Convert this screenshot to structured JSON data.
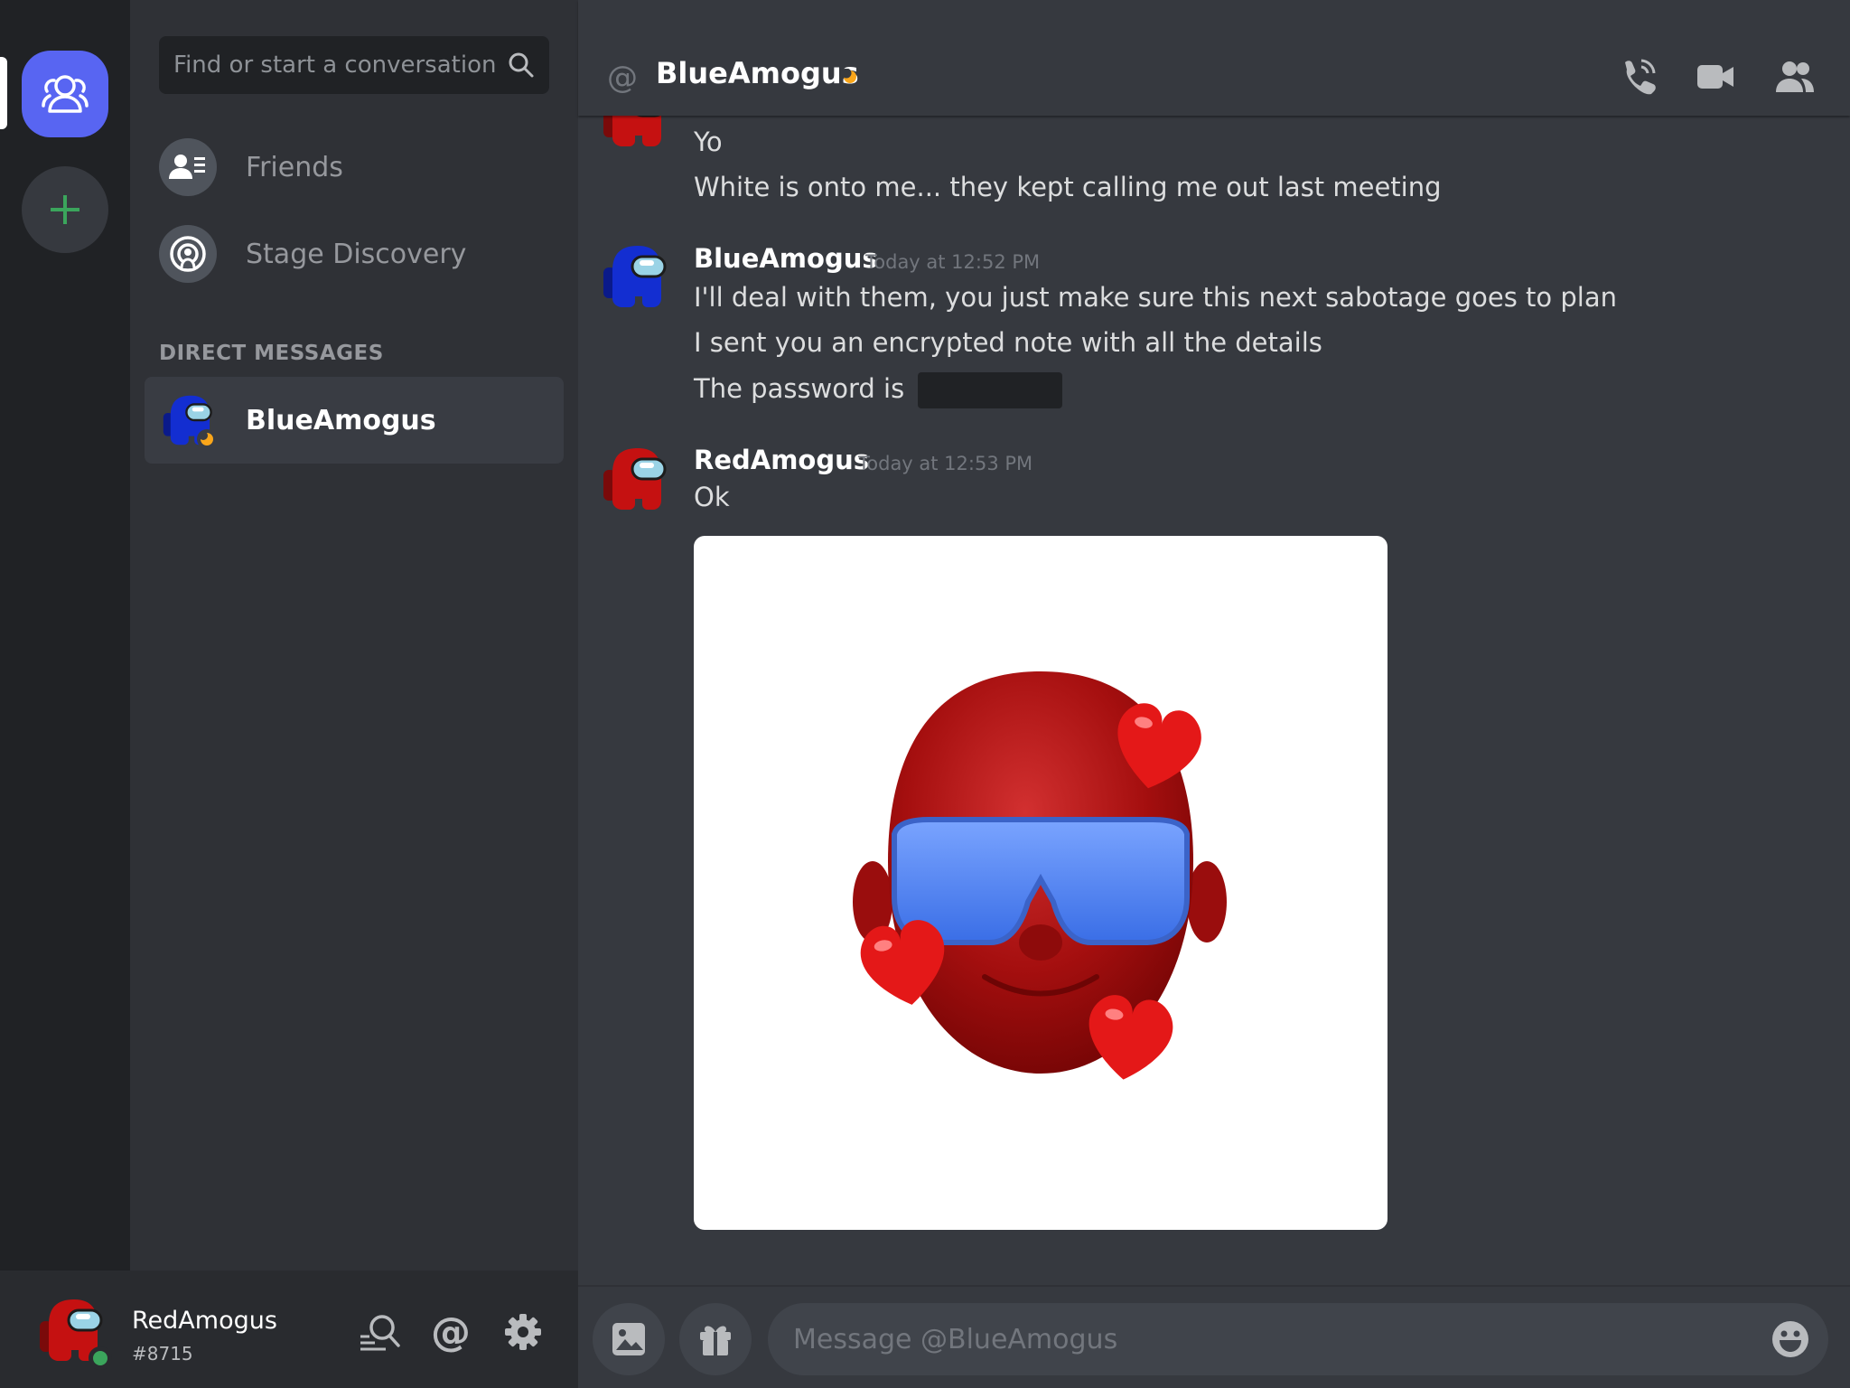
{
  "sidebar": {
    "search_placeholder": "Find or start a conversation",
    "nav": [
      {
        "label": "Friends"
      },
      {
        "label": "Stage Discovery"
      }
    ],
    "dm_header": "DIRECT MESSAGES",
    "dms": [
      {
        "name": "BlueAmogus",
        "status": "idle"
      }
    ]
  },
  "user": {
    "name": "RedAmogus",
    "tag": "#8715",
    "status": "online"
  },
  "header": {
    "channel_name": "BlueAmogus",
    "status": "idle"
  },
  "messages": {
    "group1": {
      "lines": [
        "Yo",
        "White is onto me... they kept calling me out last meeting"
      ]
    },
    "group2": {
      "author": "BlueAmogus",
      "time": "Today at 12:52 PM",
      "lines": [
        "I'll deal with them, you just make sure this next sabotage goes to plan",
        "I sent you an encrypted note with all the details",
        "The password is"
      ],
      "spoiler_hidden": true
    },
    "group3": {
      "author": "RedAmogus",
      "time": "Today at 12:53 PM",
      "lines": [
        "Ok"
      ],
      "attachment": "memoji-red-face-sunglasses-hearts"
    }
  },
  "composer": {
    "placeholder": "Message @BlueAmogus"
  },
  "colors": {
    "accent": "#5865f2",
    "online": "#3ba55c",
    "idle": "#faa61a",
    "red_crewmate": "#c51111",
    "blue_crewmate": "#132ed1"
  }
}
